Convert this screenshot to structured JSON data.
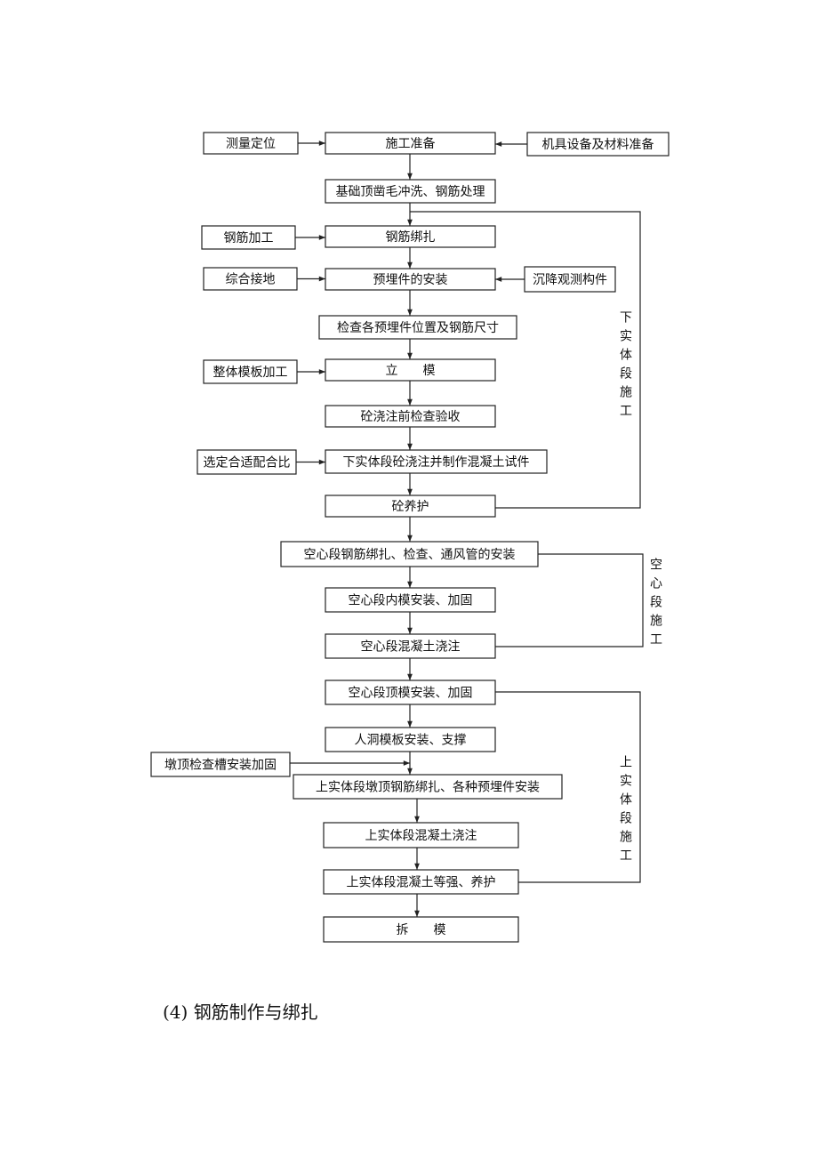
{
  "diagram": {
    "type": "flowchart",
    "nodes": [
      {
        "id": "survey",
        "label": "测量定位"
      },
      {
        "id": "prep",
        "label": "施工准备"
      },
      {
        "id": "equip",
        "label": "机具设备及材料准备"
      },
      {
        "id": "base",
        "label": "基础顶凿毛冲洗、钢筋处理"
      },
      {
        "id": "rebar_proc",
        "label": "钢筋加工"
      },
      {
        "id": "rebar_tie",
        "label": "钢筋绑扎"
      },
      {
        "id": "ground",
        "label": "综合接地"
      },
      {
        "id": "embed",
        "label": "预埋件的安装"
      },
      {
        "id": "settle",
        "label": "沉降观测构件"
      },
      {
        "id": "check",
        "label": "检查各预埋件位置及钢筋尺寸"
      },
      {
        "id": "form_proc",
        "label": "整体模板加工"
      },
      {
        "id": "formwork",
        "label": "立　　模"
      },
      {
        "id": "precheck",
        "label": "砼浇注前检查验收"
      },
      {
        "id": "mix",
        "label": "选定合适配合比"
      },
      {
        "id": "lower_pour",
        "label": "下实体段砼浇注并制作混凝土试件"
      },
      {
        "id": "cure",
        "label": "砼养护"
      },
      {
        "id": "hollow_rebar",
        "label": "空心段钢筋绑扎、检查、通风管的安装"
      },
      {
        "id": "hollow_inner",
        "label": "空心段内模安装、加固"
      },
      {
        "id": "hollow_pour",
        "label": "空心段混凝土浇注"
      },
      {
        "id": "hollow_top",
        "label": "空心段顶模安装、加固"
      },
      {
        "id": "manhole",
        "label": "人洞模板安装、支撑"
      },
      {
        "id": "pier_slot",
        "label": "墩顶检查槽安装加固"
      },
      {
        "id": "upper_rebar",
        "label": "上实体段墩顶钢筋绑扎、各种预埋件安装"
      },
      {
        "id": "upper_pour",
        "label": "上实体段混凝土浇注"
      },
      {
        "id": "upper_cure",
        "label": "上实体段混凝土等强、养护"
      },
      {
        "id": "strip",
        "label": "拆　　模"
      }
    ],
    "group_labels": [
      {
        "id": "lower",
        "label": "下实体段施工"
      },
      {
        "id": "hollow",
        "label": "空心段施工"
      },
      {
        "id": "upper",
        "label": "上实体段施工"
      }
    ],
    "edges": [
      [
        "survey",
        "prep"
      ],
      [
        "equip",
        "prep"
      ],
      [
        "prep",
        "base"
      ],
      [
        "base",
        "rebar_tie"
      ],
      [
        "rebar_proc",
        "rebar_tie"
      ],
      [
        "rebar_tie",
        "embed"
      ],
      [
        "ground",
        "embed"
      ],
      [
        "settle",
        "embed"
      ],
      [
        "embed",
        "check"
      ],
      [
        "check",
        "formwork"
      ],
      [
        "form_proc",
        "formwork"
      ],
      [
        "formwork",
        "precheck"
      ],
      [
        "precheck",
        "lower_pour"
      ],
      [
        "mix",
        "lower_pour"
      ],
      [
        "lower_pour",
        "cure"
      ],
      [
        "cure",
        "hollow_rebar"
      ],
      [
        "hollow_rebar",
        "hollow_inner"
      ],
      [
        "hollow_inner",
        "hollow_pour"
      ],
      [
        "hollow_pour",
        "hollow_top"
      ],
      [
        "hollow_top",
        "manhole"
      ],
      [
        "manhole",
        "upper_rebar"
      ],
      [
        "pier_slot",
        "upper_rebar"
      ],
      [
        "upper_rebar",
        "upper_pour"
      ],
      [
        "upper_pour",
        "upper_cure"
      ],
      [
        "upper_cure",
        "strip"
      ]
    ]
  },
  "section_heading": "(4)  钢筋制作与绑扎"
}
